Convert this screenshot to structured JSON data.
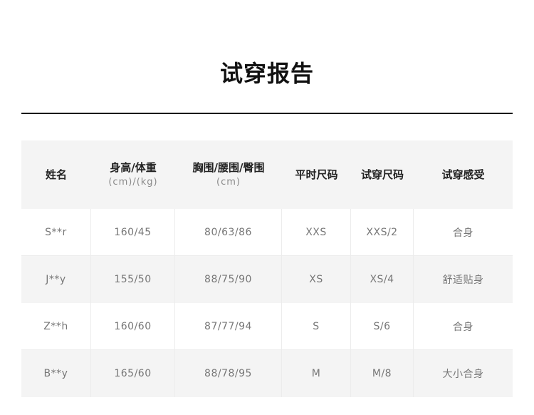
{
  "title": "试穿报告",
  "table": {
    "headers": [
      {
        "main": "姓名",
        "sub": ""
      },
      {
        "main": "身高/体重",
        "sub": "(cm)/(kg)"
      },
      {
        "main": "胸围/腰围/臀围",
        "sub": "(cm)"
      },
      {
        "main": "平时尺码",
        "sub": ""
      },
      {
        "main": "试穿尺码",
        "sub": ""
      },
      {
        "main": "试穿感受",
        "sub": ""
      }
    ],
    "rows": [
      [
        "S**r",
        "160/45",
        "80/63/86",
        "XXS",
        "XXS/2",
        "合身"
      ],
      [
        "J**y",
        "155/50",
        "88/75/90",
        "XS",
        "XS/4",
        "舒适贴身"
      ],
      [
        "Z**h",
        "160/60",
        "87/77/94",
        "S",
        "S/6",
        "合身"
      ],
      [
        "B**y",
        "165/60",
        "88/78/95",
        "M",
        "M/8",
        "大小合身"
      ]
    ]
  }
}
